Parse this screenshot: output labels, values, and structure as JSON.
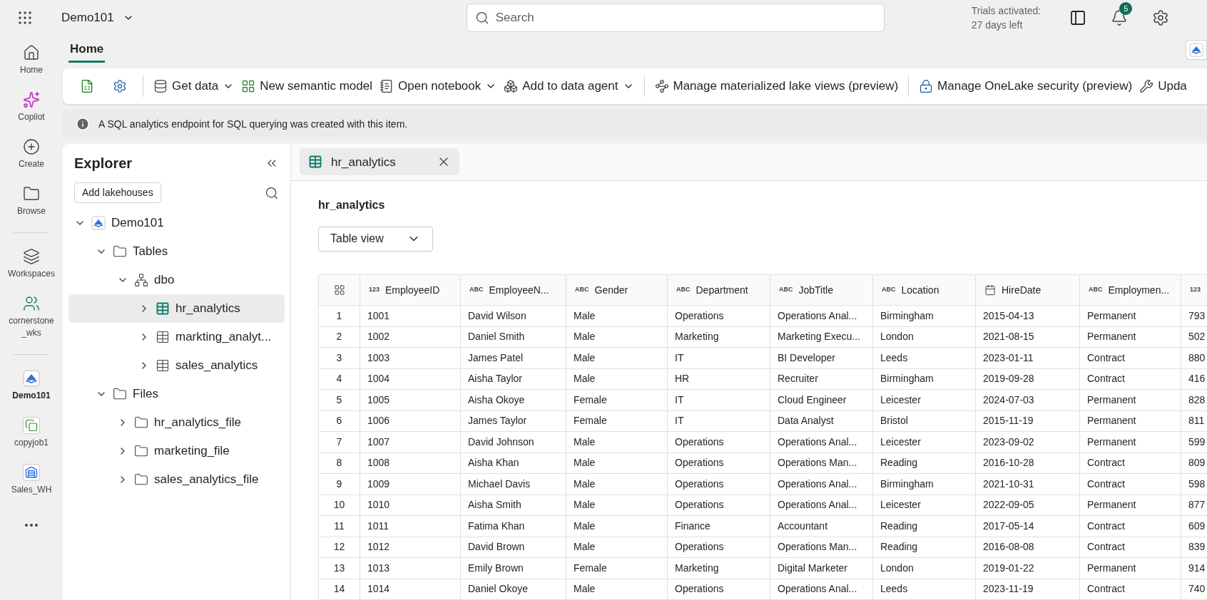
{
  "top_bar": {
    "workspace": "Demo101",
    "search": {
      "placeholder": "Search"
    },
    "trial": [
      "Trials activated:",
      "27 days left"
    ],
    "notifications": "5"
  },
  "rail": [
    {
      "label": "Home",
      "kind": "home",
      "selected": false
    },
    {
      "label": "Copilot",
      "kind": "copilot",
      "selected": false
    },
    {
      "label": "Create",
      "kind": "create",
      "selected": false
    },
    {
      "label": "Browse",
      "kind": "browse",
      "selected": false
    },
    {
      "label": "Workspaces",
      "kind": "workspaces",
      "selected": false
    },
    {
      "label": "cornerstone _wks",
      "kind": "people",
      "selected": false
    },
    {
      "label": "Demo101",
      "kind": "lakehouse",
      "selected": true
    },
    {
      "label": "copyjob1",
      "kind": "copyjob",
      "selected": false
    },
    {
      "label": "Sales_WH",
      "kind": "warehouse",
      "selected": false
    }
  ],
  "ribbon": {
    "tabs": [
      {
        "label": "Home",
        "selected": true
      }
    ],
    "tools": [
      {
        "kind": "refresh"
      },
      {
        "kind": "settings"
      },
      {
        "kind": "divider"
      },
      {
        "kind": "getdata",
        "label": "Get data",
        "dropdown": true
      },
      {
        "kind": "model",
        "label": "New semantic model",
        "dropdown": false
      },
      {
        "kind": "notebook",
        "label": "Open notebook",
        "dropdown": true
      },
      {
        "kind": "agent",
        "label": "Add to data agent",
        "dropdown": true
      },
      {
        "kind": "divider"
      },
      {
        "kind": "views",
        "label": "Manage materialized lake views (preview)",
        "dropdown": false
      },
      {
        "kind": "divider"
      },
      {
        "kind": "security",
        "label": "Manage OneLake security (preview)",
        "dropdown": false
      },
      {
        "kind": "update",
        "label": "Upda",
        "dropdown": false
      }
    ]
  },
  "info": "A SQL analytics endpoint for SQL querying was created with this item.",
  "explorer": {
    "title": "Explorer",
    "add_button": "Add lakehouses",
    "tree": [
      {
        "label": "Demo101",
        "kind": "lakehouse",
        "expanded": true,
        "selected": false,
        "children": [
          {
            "label": "Tables",
            "kind": "folder",
            "expanded": true,
            "selected": false,
            "children": [
              {
                "label": "dbo",
                "kind": "schema",
                "expanded": true,
                "selected": false,
                "children": [
                  {
                    "label": "hr_analytics",
                    "kind": "table",
                    "expanded": false,
                    "selected": true
                  },
                  {
                    "label": "markting_analyt...",
                    "kind": "table",
                    "expanded": false,
                    "selected": false
                  },
                  {
                    "label": "sales_analytics",
                    "kind": "table",
                    "expanded": false,
                    "selected": false
                  }
                ]
              }
            ]
          },
          {
            "label": "Files",
            "kind": "folder",
            "expanded": true,
            "selected": false,
            "children": [
              {
                "label": "hr_analytics_file",
                "kind": "folder",
                "expanded": false,
                "selected": false
              },
              {
                "label": "marketing_file",
                "kind": "folder",
                "expanded": false,
                "selected": false
              },
              {
                "label": "sales_analytics_file",
                "kind": "folder",
                "expanded": false,
                "selected": false
              }
            ]
          }
        ]
      }
    ]
  },
  "doc_tabs": [
    {
      "label": "hr_analytics",
      "selected": true
    }
  ],
  "view": {
    "title": "hr_analytics",
    "mode": "Table view"
  },
  "table": {
    "columns": [
      {
        "kind": "corner"
      },
      {
        "kind": "badge",
        "badge": "123",
        "label": "EmployeeID"
      },
      {
        "kind": "badge",
        "badge": "ABC",
        "label": "EmployeeN..."
      },
      {
        "kind": "badge",
        "badge": "ABC",
        "label": "Gender"
      },
      {
        "kind": "badge",
        "badge": "ABC",
        "label": "Department"
      },
      {
        "kind": "badge",
        "badge": "ABC",
        "label": "JobTitle"
      },
      {
        "kind": "badge",
        "badge": "ABC",
        "label": "Location"
      },
      {
        "kind": "date",
        "label": "HireDate"
      },
      {
        "kind": "badge",
        "badge": "ABC",
        "label": "Employmen..."
      },
      {
        "kind": "badge",
        "badge": "123"
      }
    ],
    "rows": [
      [
        "1",
        "1001",
        "David Wilson",
        "Male",
        "Operations",
        "Operations Anal...",
        "Birmingham",
        "2015-04-13",
        "Permanent",
        "793"
      ],
      [
        "2",
        "1002",
        "Daniel Smith",
        "Male",
        "Marketing",
        "Marketing Execu...",
        "London",
        "2021-08-15",
        "Permanent",
        "502"
      ],
      [
        "3",
        "1003",
        "James Patel",
        "Male",
        "IT",
        "BI Developer",
        "Leeds",
        "2023-01-11",
        "Contract",
        "880"
      ],
      [
        "4",
        "1004",
        "Aisha Taylor",
        "Male",
        "HR",
        "Recruiter",
        "Birmingham",
        "2019-09-28",
        "Contract",
        "416"
      ],
      [
        "5",
        "1005",
        "Aisha Okoye",
        "Female",
        "IT",
        "Cloud Engineer",
        "Leicester",
        "2024-07-03",
        "Permanent",
        "828"
      ],
      [
        "6",
        "1006",
        "James Taylor",
        "Female",
        "IT",
        "Data Analyst",
        "Bristol",
        "2015-11-19",
        "Permanent",
        "811"
      ],
      [
        "7",
        "1007",
        "David Johnson",
        "Male",
        "Operations",
        "Operations Anal...",
        "Leicester",
        "2023-09-02",
        "Permanent",
        "599"
      ],
      [
        "8",
        "1008",
        "Aisha Khan",
        "Male",
        "Operations",
        "Operations Man...",
        "Reading",
        "2016-10-28",
        "Contract",
        "809"
      ],
      [
        "9",
        "1009",
        "Michael Davis",
        "Male",
        "Operations",
        "Operations Anal...",
        "Birmingham",
        "2021-10-31",
        "Contract",
        "598"
      ],
      [
        "10",
        "1010",
        "Aisha Smith",
        "Male",
        "Operations",
        "Operations Anal...",
        "Leicester",
        "2022-09-05",
        "Permanent",
        "877"
      ],
      [
        "11",
        "1011",
        "Fatima Khan",
        "Male",
        "Finance",
        "Accountant",
        "Reading",
        "2017-05-14",
        "Contract",
        "609"
      ],
      [
        "12",
        "1012",
        "David Brown",
        "Male",
        "Operations",
        "Operations Man...",
        "Reading",
        "2016-08-08",
        "Contract",
        "839"
      ],
      [
        "13",
        "1013",
        "Emily Brown",
        "Female",
        "Marketing",
        "Digital Marketer",
        "London",
        "2019-01-22",
        "Permanent",
        "914"
      ],
      [
        "14",
        "1014",
        "Daniel Okoye",
        "Male",
        "Operations",
        "Operations Anal...",
        "Leeds",
        "2023-11-19",
        "Contract",
        "740"
      ]
    ]
  }
}
